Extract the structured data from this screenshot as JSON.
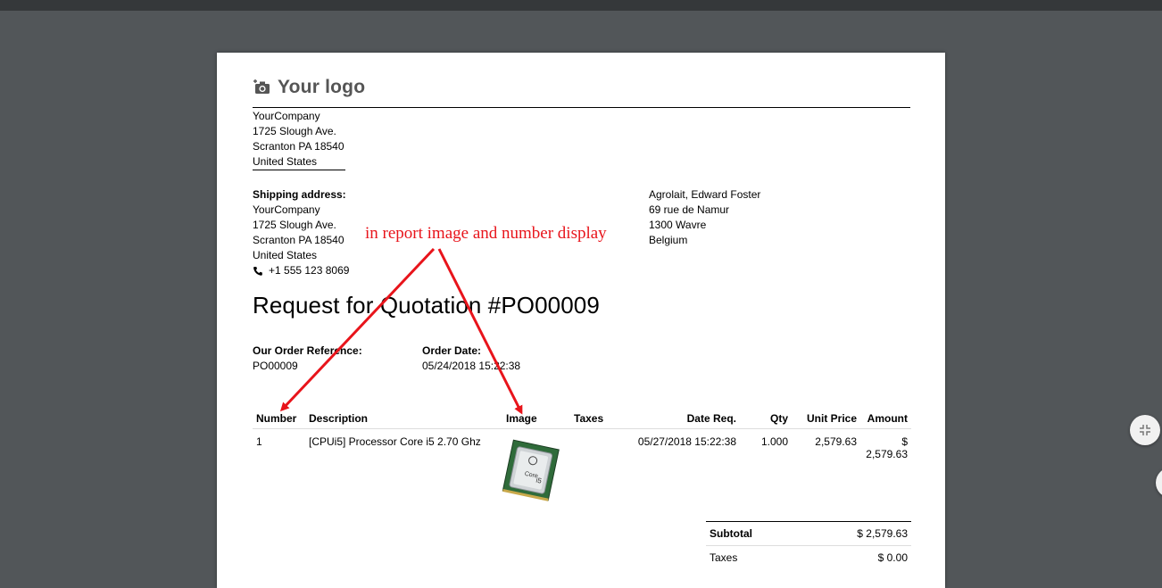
{
  "logo": {
    "text": "Your logo",
    "icon": "camera-icon"
  },
  "company": {
    "name": "YourCompany",
    "street": "1725 Slough Ave.",
    "city": "Scranton PA 18540",
    "country": "United States"
  },
  "shipping": {
    "label": "Shipping address:",
    "name": "YourCompany",
    "street": "1725 Slough Ave.",
    "city": "Scranton PA 18540",
    "country": "United States",
    "phone": "+1 555 123 8069"
  },
  "vendor": {
    "name": "Agrolait, Edward Foster",
    "street": "69 rue de Namur",
    "city": "1300 Wavre",
    "country": "Belgium"
  },
  "title": "Request for Quotation #PO00009",
  "order_ref": {
    "label": "Our Order Reference:",
    "value": "PO00009"
  },
  "order_date": {
    "label": "Order Date:",
    "value": "05/24/2018 15:22:38"
  },
  "table": {
    "headers": [
      "Number",
      "Description",
      "Image",
      "Taxes",
      "Date Req.",
      "Qty",
      "Unit Price",
      "Amount"
    ],
    "rows": [
      {
        "number": "1",
        "description": "[CPUi5] Processor Core i5 2.70 Ghz",
        "image": "cpu-chip-image",
        "taxes": "",
        "date_req": "05/27/2018 15:22:38",
        "qty": "1.000",
        "unit_price": "2,579.63",
        "amount": "$ 2,579.63"
      }
    ]
  },
  "totals": {
    "subtotal_label": "Subtotal",
    "subtotal_value": "$ 2,579.63",
    "taxes_label": "Taxes",
    "taxes_value": "$ 0.00"
  },
  "annotation": {
    "text": "in report image and number display",
    "color": "#e8141b"
  },
  "colors": {
    "viewer_bg": "#525659",
    "toolbar": "#35383a"
  }
}
